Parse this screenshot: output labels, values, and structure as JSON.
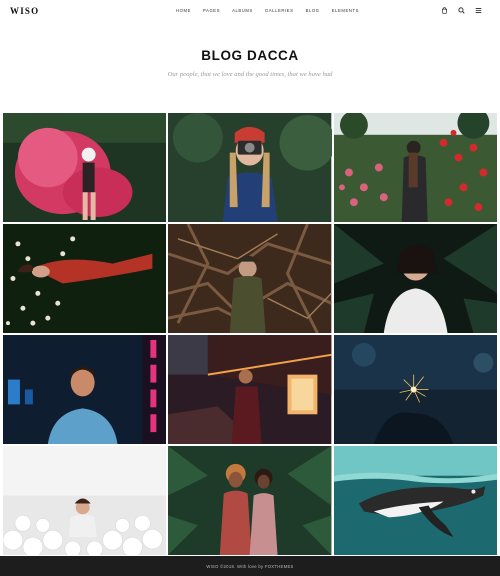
{
  "brand": {
    "logo": "WISO"
  },
  "nav": [
    "HOME",
    "PAGES",
    "ALBUMS",
    "GALLERIES",
    "BLOG",
    "ELEMENTS"
  ],
  "tools": [
    "bag-icon",
    "search-icon",
    "menu-icon"
  ],
  "page": {
    "title": "BLOG DACCA",
    "subtitle": "Our people, that we love and the good times, that we have had"
  },
  "gallery": [
    {
      "subject": "woman in pink smoke",
      "bg": "#1f3524"
    },
    {
      "subject": "woman with camera and red beanie",
      "bg": "#27402d"
    },
    {
      "subject": "woman in rose garden",
      "bg": "#3b5a34"
    },
    {
      "subject": "woman lying in flowers",
      "bg": "#10200f"
    },
    {
      "subject": "woman among branches",
      "bg": "#3d2a1c"
    },
    {
      "subject": "woman in palm leaves",
      "bg": "#0f1a14"
    },
    {
      "subject": "man with neon lights",
      "bg": "#0f1d30"
    },
    {
      "subject": "man in neon street",
      "bg": "#2a1b25"
    },
    {
      "subject": "hands with sparklers",
      "bg": "#142331"
    },
    {
      "subject": "woman in white balloons",
      "bg": "#e9e8e8"
    },
    {
      "subject": "couple among tropical leaves",
      "bg": "#1e3a28"
    },
    {
      "subject": "penguin swimming",
      "bg": "#1c6a6f"
    }
  ],
  "footer": {
    "text": "WISO ©2018. With love by FOXTHEMES"
  }
}
